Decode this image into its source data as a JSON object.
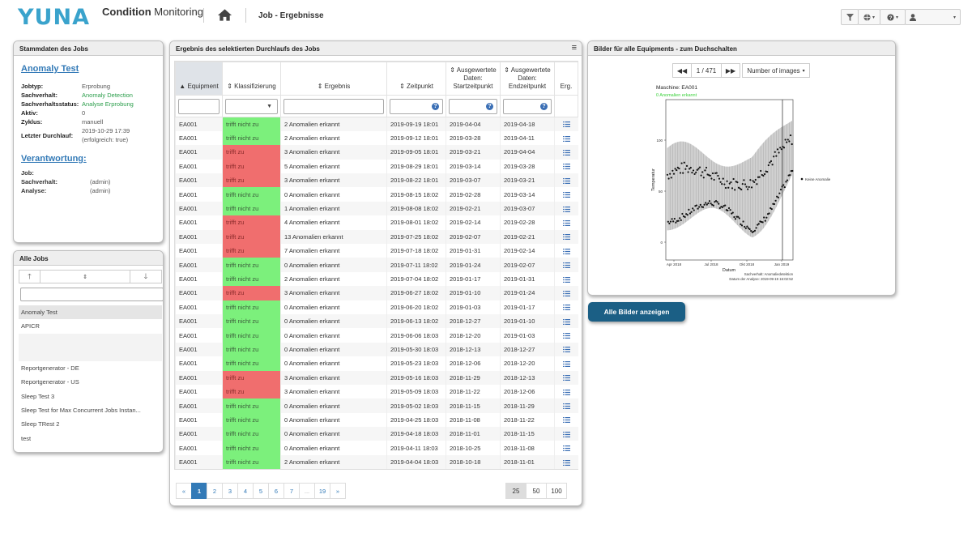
{
  "header": {
    "logo": "YUNA",
    "app_title_bold": "Condition",
    "app_title_rest": " Monitoring",
    "page_title": "Job - Ergebnisse",
    "buttons": [
      "filter-icon",
      "globe-icon",
      "help-icon",
      "user-icon"
    ]
  },
  "stammdaten": {
    "title": "Stammdaten des Jobs",
    "job_name": "Anomaly Test",
    "fields": [
      {
        "key": "Jobtyp:",
        "value": "Erprobung",
        "color": "#555555"
      },
      {
        "key": "Sachverhalt:",
        "value": "Anomaly Detection",
        "color": "#2a9d4a"
      },
      {
        "key": "Sachverhaltsstatus:",
        "value": "Analyse Erprobung",
        "color": "#2a9d4a"
      },
      {
        "key": "Aktiv:",
        "value": "0",
        "color": "#555555"
      },
      {
        "key": "Zyklus:",
        "value": "manuell",
        "color": "#555555"
      },
      {
        "key": "Letzter Durchlauf:",
        "value": "2019-10-29 17:39",
        "value2": "(erfolgreich: true)",
        "color": "#555555"
      }
    ],
    "responsibility_title": "Verantwortung:",
    "responsibility": [
      {
        "key": "Job:",
        "value": ""
      },
      {
        "key": "Sachverhalt:",
        "value": "(admin)"
      },
      {
        "key": "Analyse:",
        "value": "(admin)"
      }
    ]
  },
  "jobs": {
    "title": "Alle Jobs",
    "items": [
      "Anomaly Test",
      "APICR",
      "",
      "",
      "Reportgenerator - DE",
      "Reportgenerator - US",
      "Sleep Test 3",
      "Sleep Test for Max Concurrent Jobs Instan...",
      "Sleep TRest 2",
      "test"
    ],
    "selected_index": 0
  },
  "results": {
    "title": "Ergebnis des selektierten Durchlaufs des Jobs",
    "columns": [
      "Equipment",
      "Klassifizierung",
      "Ergebnis",
      "Zeitpunkt",
      "Ausgewertete Daten: Startzeitpunkt",
      "Ausgewertete Daten: Endzeitpunkt",
      "Erg."
    ],
    "rows": [
      [
        "EA001",
        "trifft nicht zu",
        "2 Anomalien erkannt",
        "2019-09-19 18:01",
        "2019-04-04",
        "2019-04-18"
      ],
      [
        "EA001",
        "trifft nicht zu",
        "2 Anomalien erkannt",
        "2019-09-12 18:01",
        "2019-03-28",
        "2019-04-11"
      ],
      [
        "EA001",
        "trifft zu",
        "3 Anomalien erkannt",
        "2019-09-05 18:01",
        "2019-03-21",
        "2019-04-04"
      ],
      [
        "EA001",
        "trifft zu",
        "5 Anomalien erkannt",
        "2019-08-29 18:01",
        "2019-03-14",
        "2019-03-28"
      ],
      [
        "EA001",
        "trifft zu",
        "3 Anomalien erkannt",
        "2019-08-22 18:01",
        "2019-03-07",
        "2019-03-21"
      ],
      [
        "EA001",
        "trifft nicht zu",
        "0 Anomalien erkannt",
        "2019-08-15 18:02",
        "2019-02-28",
        "2019-03-14"
      ],
      [
        "EA001",
        "trifft nicht zu",
        "1 Anomalien erkannt",
        "2019-08-08 18:02",
        "2019-02-21",
        "2019-03-07"
      ],
      [
        "EA001",
        "trifft zu",
        "4 Anomalien erkannt",
        "2019-08-01 18:02",
        "2019-02-14",
        "2019-02-28"
      ],
      [
        "EA001",
        "trifft zu",
        "13 Anomalien erkannt",
        "2019-07-25 18:02",
        "2019-02-07",
        "2019-02-21"
      ],
      [
        "EA001",
        "trifft zu",
        "7 Anomalien erkannt",
        "2019-07-18 18:02",
        "2019-01-31",
        "2019-02-14"
      ],
      [
        "EA001",
        "trifft nicht zu",
        "0 Anomalien erkannt",
        "2019-07-11 18:02",
        "2019-01-24",
        "2019-02-07"
      ],
      [
        "EA001",
        "trifft nicht zu",
        "2 Anomalien erkannt",
        "2019-07-04 18:02",
        "2019-01-17",
        "2019-01-31"
      ],
      [
        "EA001",
        "trifft zu",
        "3 Anomalien erkannt",
        "2019-06-27 18:02",
        "2019-01-10",
        "2019-01-24"
      ],
      [
        "EA001",
        "trifft nicht zu",
        "0 Anomalien erkannt",
        "2019-06-20 18:02",
        "2019-01-03",
        "2019-01-17"
      ],
      [
        "EA001",
        "trifft nicht zu",
        "0 Anomalien erkannt",
        "2019-06-13 18:02",
        "2018-12-27",
        "2019-01-10"
      ],
      [
        "EA001",
        "trifft nicht zu",
        "0 Anomalien erkannt",
        "2019-06-06 18:03",
        "2018-12-20",
        "2019-01-03"
      ],
      [
        "EA001",
        "trifft nicht zu",
        "0 Anomalien erkannt",
        "2019-05-30 18:03",
        "2018-12-13",
        "2018-12-27"
      ],
      [
        "EA001",
        "trifft nicht zu",
        "0 Anomalien erkannt",
        "2019-05-23 18:03",
        "2018-12-06",
        "2018-12-20"
      ],
      [
        "EA001",
        "trifft zu",
        "3 Anomalien erkannt",
        "2019-05-16 18:03",
        "2018-11-29",
        "2018-12-13"
      ],
      [
        "EA001",
        "trifft zu",
        "3 Anomalien erkannt",
        "2019-05-09 18:03",
        "2018-11-22",
        "2018-12-06"
      ],
      [
        "EA001",
        "trifft nicht zu",
        "0 Anomalien erkannt",
        "2019-05-02 18:03",
        "2018-11-15",
        "2018-11-29"
      ],
      [
        "EA001",
        "trifft nicht zu",
        "0 Anomalien erkannt",
        "2019-04-25 18:03",
        "2018-11-08",
        "2018-11-22"
      ],
      [
        "EA001",
        "trifft nicht zu",
        "0 Anomalien erkannt",
        "2019-04-18 18:03",
        "2018-11-01",
        "2018-11-15"
      ],
      [
        "EA001",
        "trifft nicht zu",
        "0 Anomalien erkannt",
        "2019-04-11 18:03",
        "2018-10-25",
        "2018-11-08"
      ],
      [
        "EA001",
        "trifft nicht zu",
        "2 Anomalien erkannt",
        "2019-04-04 18:03",
        "2018-10-18",
        "2018-11-01"
      ]
    ],
    "colors": {
      "match": "#f06e6e",
      "no_match": "#7cf07c"
    },
    "pager": [
      "«",
      "1",
      "2",
      "3",
      "4",
      "5",
      "6",
      "7",
      "...",
      "19",
      "»"
    ],
    "active_page": "1",
    "page_sizes": [
      "25",
      "50",
      "100"
    ],
    "active_size": "25"
  },
  "images": {
    "title": "Bilder für alle Equipments - zum Duchschalten",
    "counter": "1 / 471",
    "dropdown": "Number of images",
    "plot": {
      "machine": "Maschine: EA001",
      "anomalies": "0 Anomalien erkannt",
      "xlabel": "Datum",
      "ylabel": "Temperatur",
      "legend": "Keine Anomalie",
      "footer1": "Sachverhalt: Anomaliedetektion",
      "footer2": "Datum der Analyse: 2019-09-19 16:02:52",
      "xticks": [
        "Apr 2018",
        "Jul 2018",
        "Okt 2018",
        "Jan 2019"
      ],
      "yticks": [
        "0",
        "50",
        "100"
      ]
    },
    "all_button": "Alle Bilder anzeigen"
  }
}
